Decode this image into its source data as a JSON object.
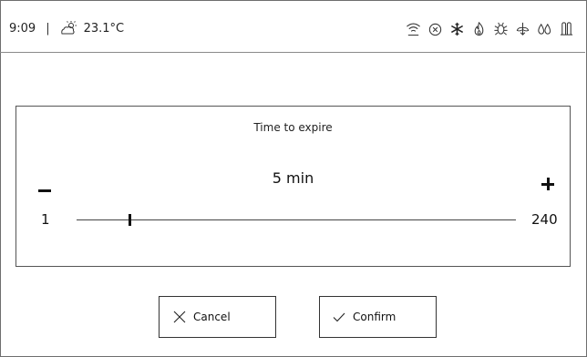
{
  "status_bar": {
    "time": "9:09",
    "separator": "|",
    "temperature": "23.1°C",
    "weather_icon": "partly-sunny-icon",
    "icons": [
      "wifi-icon",
      "circle-x-icon",
      "snowflake-icon",
      "flame-icon",
      "bug-icon",
      "leaf-arrows-icon",
      "droplets-icon",
      "temperature-sensor-icon"
    ]
  },
  "dialog": {
    "title": "Time to expire",
    "value_label": "5 min",
    "min": 1,
    "max": 240,
    "value": 5,
    "min_label": "1",
    "max_label": "240"
  },
  "buttons": {
    "cancel_label": "Cancel",
    "confirm_label": "Confirm"
  }
}
